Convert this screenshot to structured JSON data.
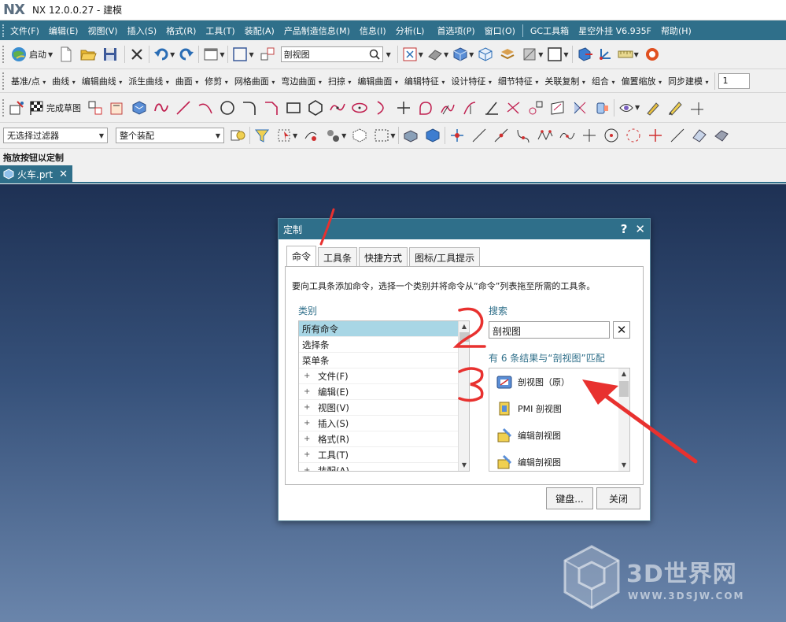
{
  "window": {
    "logo": "NX",
    "title": "NX 12.0.0.27 - 建模"
  },
  "menubar": {
    "items": [
      "文件(F)",
      "编辑(E)",
      "视图(V)",
      "插入(S)",
      "格式(R)",
      "工具(T)",
      "装配(A)",
      "产品制造信息(M)",
      "信息(I)",
      "分析(L)",
      "首选项(P)",
      "窗口(O)",
      "GC工具箱",
      "星空外挂 V6.935F",
      "帮助(H)"
    ]
  },
  "toolbar1": {
    "start_label": "启动",
    "search_value": "剖视图"
  },
  "toolbar2": {
    "items": [
      "基准/点",
      "曲线",
      "编辑曲线",
      "派生曲线",
      "曲面",
      "修剪",
      "网格曲面",
      "弯边曲面",
      "扫掠",
      "编辑曲面",
      "编辑特征",
      "设计特征",
      "细节特征",
      "关联复制",
      "组合",
      "偏置缩放",
      "同步建模"
    ],
    "number_value": "1"
  },
  "toolbar3": {
    "finish_sketch_label": "完成草图"
  },
  "toolbar4": {
    "filter_value": "无选择过滤器",
    "assembly_value": "整个装配"
  },
  "hint": "拖放按钮以定制",
  "document_tab": {
    "label": "火车.prt"
  },
  "dialog": {
    "title": "定制",
    "help_glyph": "?",
    "close_glyph": "✕",
    "tabs": [
      "命令",
      "工具条",
      "快捷方式",
      "图标/工具提示"
    ],
    "instruction": "要向工具条添加命令，选择一个类别并将命令从“命令”列表拖至所需的工具条。",
    "category_title": "类别",
    "categories": [
      {
        "label": "所有命令",
        "expandable": false,
        "selected": true
      },
      {
        "label": "选择条",
        "expandable": false,
        "selected": false
      },
      {
        "label": "菜单条",
        "expandable": false,
        "selected": false
      },
      {
        "label": "文件(F)",
        "expandable": true,
        "selected": false
      },
      {
        "label": "编辑(E)",
        "expandable": true,
        "selected": false
      },
      {
        "label": "视图(V)",
        "expandable": true,
        "selected": false
      },
      {
        "label": "插入(S)",
        "expandable": true,
        "selected": false
      },
      {
        "label": "格式(R)",
        "expandable": true,
        "selected": false
      },
      {
        "label": "工具(T)",
        "expandable": true,
        "selected": false
      },
      {
        "label": "装配(A)",
        "expandable": true,
        "selected": false
      }
    ],
    "search_title": "搜索",
    "search_value": "剖视图",
    "results_summary": "有 6 条结果与“剖视图”匹配",
    "results": [
      "剖视图（原）",
      "PMI 剖视图",
      "编辑剖视图",
      "编辑剖视图"
    ],
    "keyboard_button": "键盘...",
    "close_button": "关闭"
  },
  "annotations": {
    "color": "#e8312f",
    "step_labels": [
      "1",
      "2",
      "3"
    ]
  },
  "watermark": {
    "text": "3D世界网",
    "url": "WWW.3DSJW.COM"
  },
  "colors": {
    "accent": "#2f6f8a",
    "selection": "#a8d6e5"
  }
}
